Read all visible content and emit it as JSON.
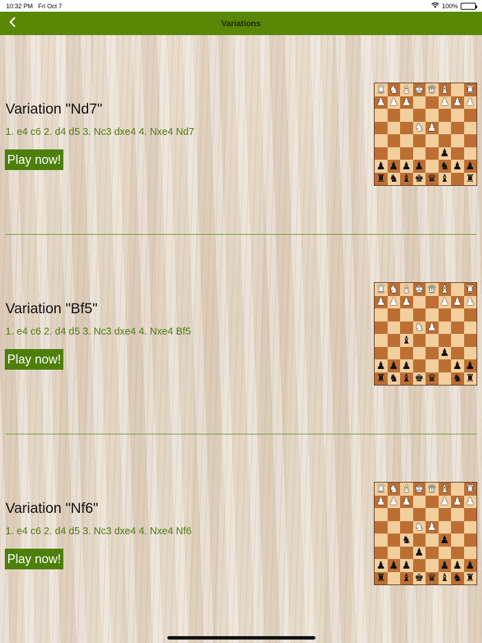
{
  "status_bar": {
    "time": "10:32 PM",
    "date": "Fri Oct 7",
    "battery_text": "100%",
    "wifi_icon": "wifi-icon",
    "battery_icon": "battery-icon"
  },
  "nav": {
    "title": "Variations",
    "back_icon": "chevron-left-icon"
  },
  "colors": {
    "nav_bar": "#5a8706",
    "play_button": "#4d7f0b",
    "moves_text": "#4e7a12",
    "light_square": "#f3cf9d",
    "dark_square": "#bd6f33"
  },
  "variations": [
    {
      "name": "Variation \"Nd7\"",
      "moves": "1. e4 c6 2. d4 d5 3. Nc3 dxe4 4. Nxe4 Nd7",
      "play_label": "Play now!",
      "board": [
        "RNBKQB.R",
        "PPP..PPP",
        "........",
        "...NP...",
        "........",
        ".....p..",
        "pppp.npp",
        "rnbkqb.r"
      ]
    },
    {
      "name": "Variation \"Bf5\"",
      "moves": "1. e4 c6 2. d4 d5 3. Nc3 dxe4 4. Nxe4 Bf5",
      "play_label": "Play now!",
      "board": [
        "RNBKQB.R",
        "PPP..PPP",
        "........",
        "...NP...",
        "..b.....",
        ".....p..",
        "ppp...pp",
        "rnbkq.nr"
      ]
    },
    {
      "name": "Variation \"Nf6\"",
      "moves": "1. e4 c6 2. d4 d5 3. Nc3 dxe4 4. Nxe4 Nf6",
      "play_label": "Play now!",
      "board": [
        "RNBKQB.R",
        "PPP..PPP",
        "........",
        "...NP...",
        "..n..p..",
        "...p....",
        "ppp..ppp",
        "r.bkqbnr"
      ]
    }
  ]
}
